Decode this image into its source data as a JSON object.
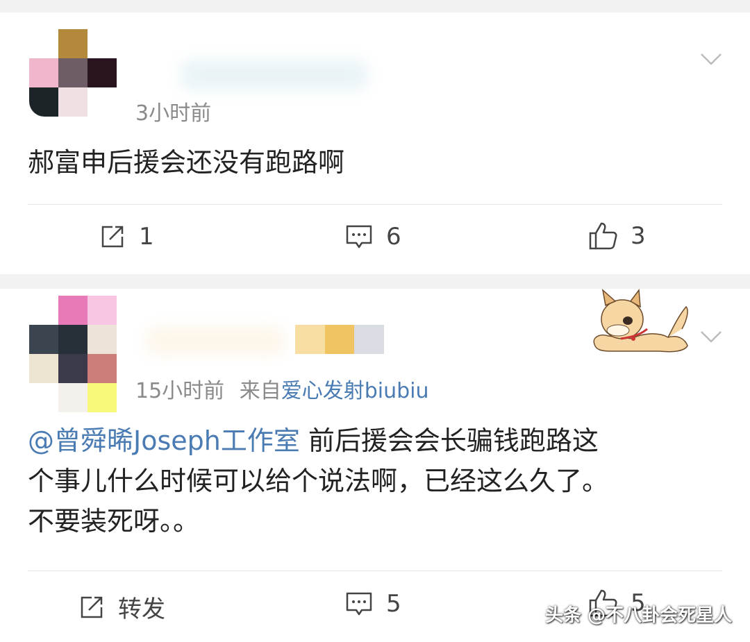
{
  "posts": [
    {
      "time": "3小时前",
      "source_prefix": "",
      "source_name": "",
      "mention": "",
      "content": "郝富申后援会还没有跑路啊",
      "actions": {
        "repost": "1",
        "comment": "6",
        "like": "3"
      }
    },
    {
      "time": "15小时前",
      "source_prefix": "来自",
      "source_name": "爱心发射biubiu",
      "mention": "@曾舜晞Joseph工作室",
      "content_line1": " 前后援会会长骗钱跑路这",
      "content_line2": "个事儿什么时候可以给个说法啊，已经这么久了。",
      "content_line3": "不要装死呀。。",
      "actions": {
        "repost": "转发",
        "comment": "5",
        "like": "5"
      }
    }
  ],
  "icons": {
    "repost": "repost-icon",
    "comment": "comment-icon",
    "like": "thumbs-up-icon",
    "chevron": "chevron-down-icon",
    "sticker": "shiba-dog-sticker"
  },
  "colors": {
    "link": "#4a7bb3",
    "meta": "#8a8a8a",
    "background": "#f2f2f2"
  },
  "watermark": "头条 @不八卦会死星人"
}
